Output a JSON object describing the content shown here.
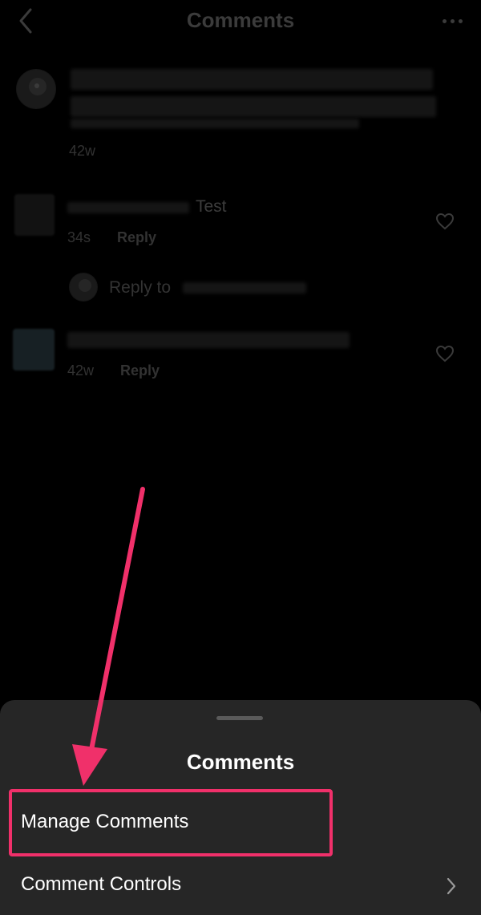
{
  "header": {
    "title": "Comments"
  },
  "caption": {
    "time": "42w"
  },
  "comments": [
    {
      "text": "Test",
      "time": "34s",
      "reply_label": "Reply"
    },
    {
      "text": "",
      "time": "42w",
      "reply_label": "Reply"
    }
  ],
  "reply_input": {
    "placeholder": "Reply to"
  },
  "sheet": {
    "title": "Comments",
    "items": [
      {
        "label": "Manage Comments"
      },
      {
        "label": "Comment Controls"
      }
    ]
  },
  "colors": {
    "highlight": "#f0306a",
    "sheet_bg": "#262626",
    "background": "#000000"
  },
  "icons": [
    "back-icon",
    "more-icon",
    "heart-icon",
    "chevron-right-icon"
  ]
}
